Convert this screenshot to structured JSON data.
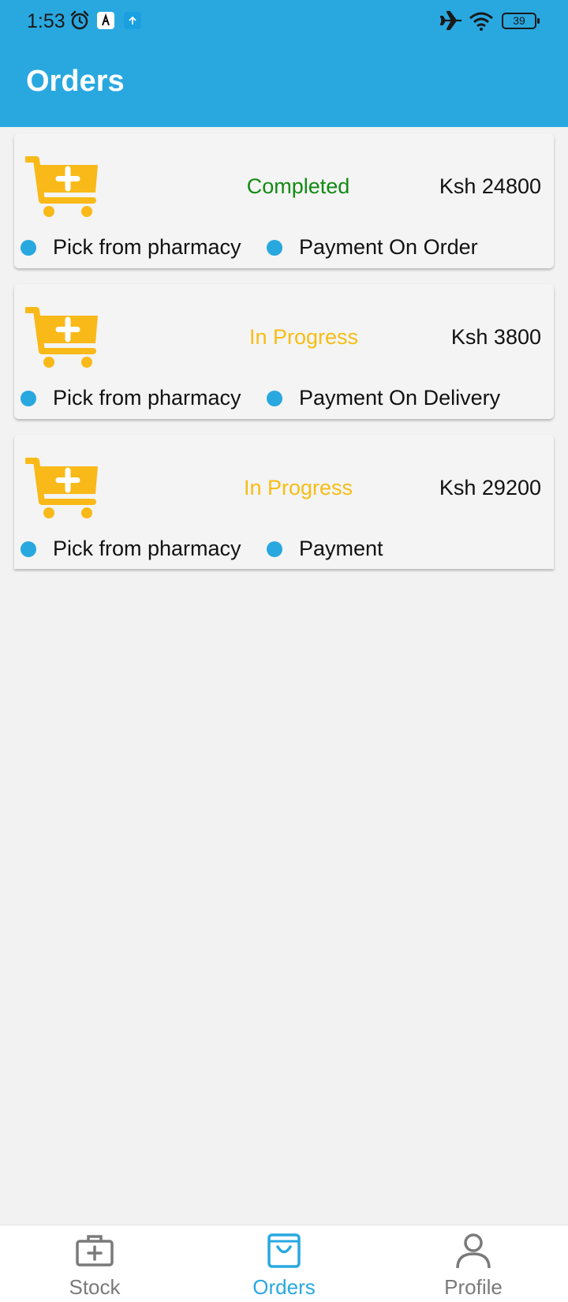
{
  "status_bar": {
    "time": "1:53",
    "battery_level": "39",
    "icons": [
      "alarm-icon",
      "app-notification-icon",
      "upload-icon",
      "airplane-mode-icon",
      "wifi-icon",
      "battery-icon"
    ]
  },
  "app_bar": {
    "title": "Orders",
    "color": "#29a8e0"
  },
  "orders": [
    {
      "status": "Completed",
      "status_color": "#138a13",
      "amount": "Ksh 24800",
      "delivery": "Pick from pharmacy",
      "payment": "Payment On Order",
      "icon": "cart-plus-icon"
    },
    {
      "status": "In Progress",
      "status_color": "#f7bd14",
      "amount": "Ksh 3800",
      "delivery": "Pick from pharmacy",
      "payment": "Payment On Delivery",
      "icon": "cart-plus-icon"
    },
    {
      "status": "In Progress",
      "status_color": "#f7bd14",
      "amount": "Ksh 29200",
      "delivery": "Pick from pharmacy",
      "payment": "Payment",
      "icon": "cart-plus-icon"
    }
  ],
  "bottom_nav": {
    "items": [
      {
        "label": "Stock",
        "icon": "medical-kit-icon",
        "active": false
      },
      {
        "label": "Orders",
        "icon": "shopping-bag-icon",
        "active": true
      },
      {
        "label": "Profile",
        "icon": "person-icon",
        "active": false
      }
    ],
    "active_color": "#29a8e0",
    "inactive_color": "#7a7a7a"
  }
}
